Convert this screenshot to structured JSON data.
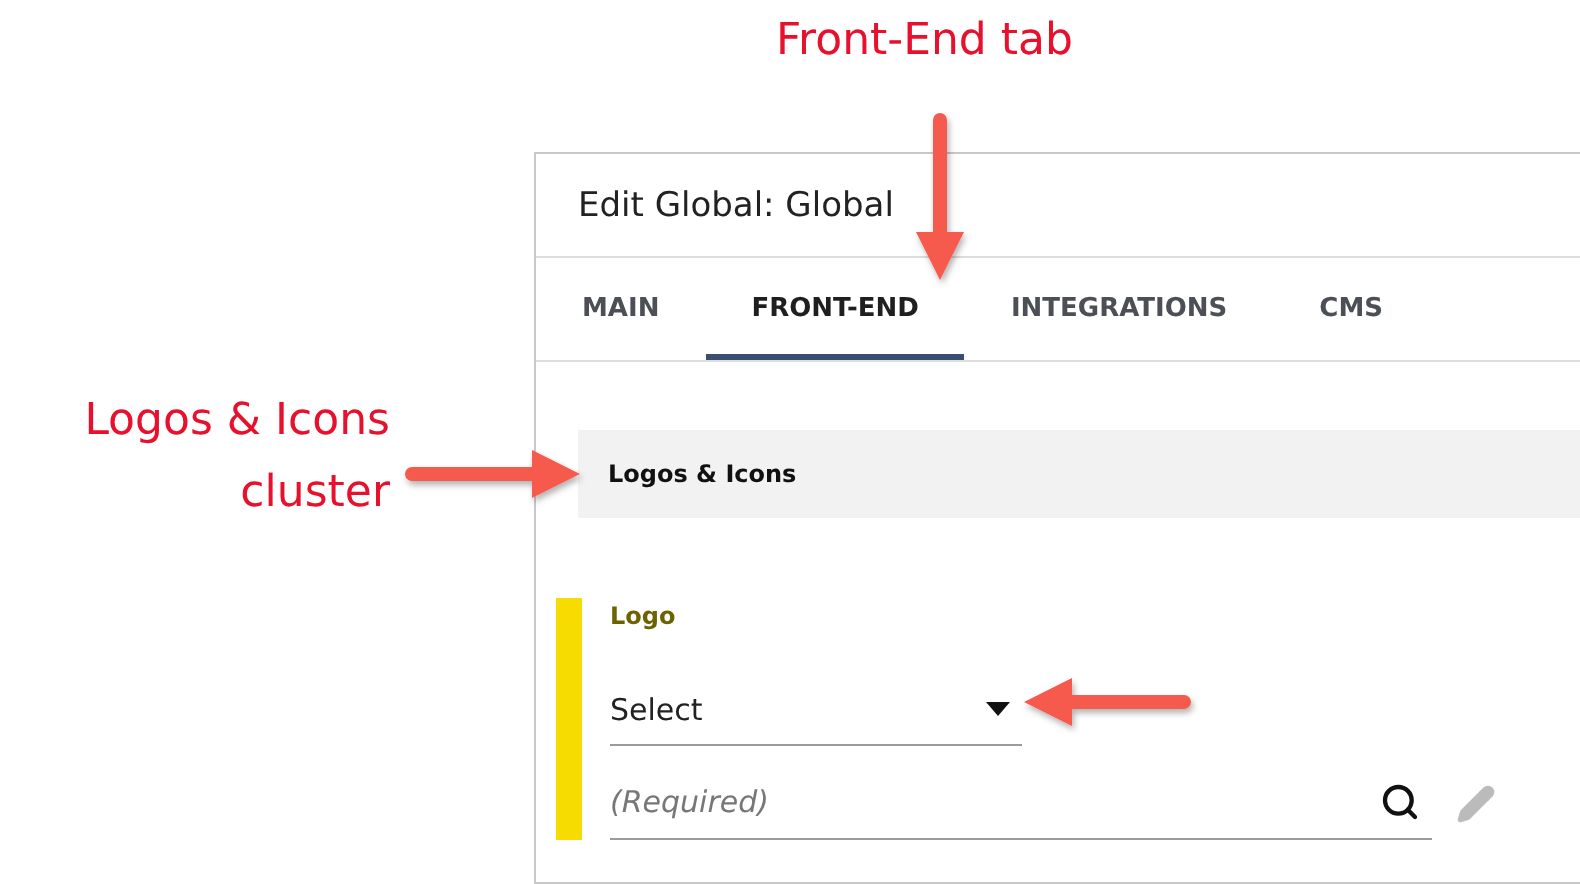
{
  "annotations": [
    {
      "kind": "top",
      "text": "Front-End tab"
    },
    {
      "kind": "side",
      "lines": [
        "Logos & Icons",
        "cluster"
      ]
    }
  ],
  "window": {
    "title": "Edit Global: Global"
  },
  "tabs": [
    {
      "label": "MAIN",
      "selected": false
    },
    {
      "label": "FRONT-END",
      "selected": true
    },
    {
      "label": "INTEGRATIONS",
      "selected": false
    },
    {
      "label": "CMS",
      "selected": false
    }
  ],
  "section": {
    "title": "Logos & Icons"
  },
  "field": {
    "label": "Logo",
    "required": true,
    "select": {
      "value": "Select"
    },
    "input": {
      "placeholder": "(Required)"
    }
  }
}
